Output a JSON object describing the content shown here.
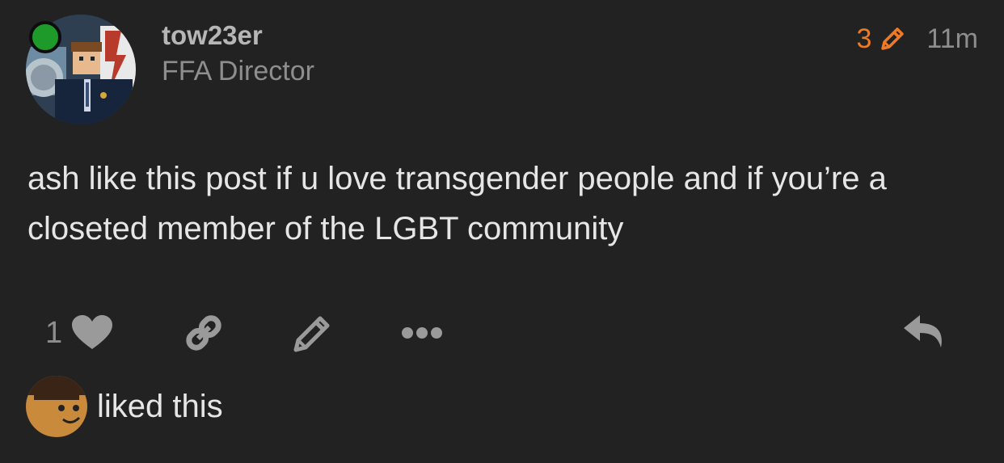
{
  "post": {
    "author": {
      "username": "tow23er",
      "title": "FFA Director",
      "online_status_color": "#1e9a2b"
    },
    "edit_count": "3",
    "edit_icon": "pencil-icon",
    "time": "11m",
    "body": "ash like this post if u love transgender people and if you’re a closeted member of the LGBT community",
    "accent_color": "#f07a24"
  },
  "actions": {
    "like_count": "1",
    "like_icon": "heart-icon",
    "link_icon": "link-icon",
    "edit_icon": "pencil-icon",
    "more_icon": "ellipsis-icon",
    "reply_icon": "reply-icon"
  },
  "likes": {
    "text": "liked this"
  }
}
